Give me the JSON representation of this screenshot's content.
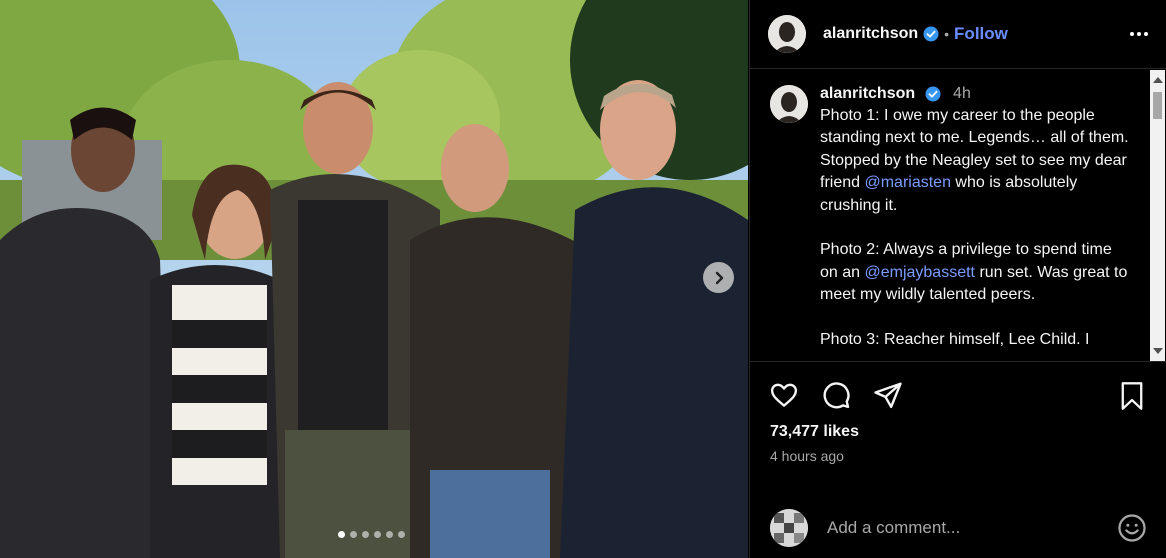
{
  "photo": {
    "alt_icon": "chevron-right-icon",
    "carousel": {
      "count": 6,
      "active_index": 0
    }
  },
  "header": {
    "username": "alanritchson",
    "separator": "•",
    "follow_label": "Follow",
    "verified_icon": "verified-badge-icon",
    "more_icon": "more-options-icon"
  },
  "caption": {
    "username": "alanritchson",
    "time": "4h",
    "paragraphs": [
      {
        "before": "Photo 1: I owe my career to the people standing next to me. Legends… all of them. Stopped by the Neagley set to see my dear friend ",
        "mention": "@mariasten",
        "after": " who is absolutely crushing it."
      },
      {
        "before": "Photo 2: Always a privilege to spend time on an ",
        "mention": "@emjaybassett",
        "after": " run set. Was great to meet my wildly talented peers."
      },
      {
        "before": "Photo 3: Reacher himself, Lee Child. I",
        "mention": "",
        "after": ""
      }
    ]
  },
  "actions": {
    "icons": [
      "heart-icon",
      "comment-icon",
      "share-icon",
      "bookmark-icon"
    ],
    "likes": "73,477 likes",
    "time_ago": "4 hours ago"
  },
  "comment": {
    "placeholder": "Add a comment...",
    "emoji_icon": "emoji-icon"
  },
  "colors": {
    "background": "#000000",
    "accent_blue": "#6b8cff",
    "mention_blue": "#7b9bff",
    "muted_text": "#a8a8a8",
    "verified": "#3797f0"
  }
}
